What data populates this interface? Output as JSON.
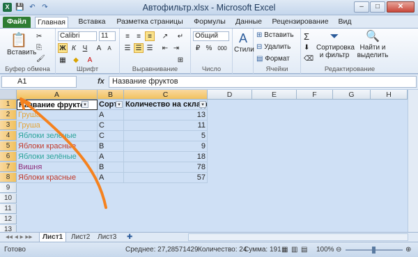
{
  "window": {
    "title": "Автофильтр.xlsx - Microsoft Excel",
    "min": "–",
    "max": "□",
    "close": "✕",
    "logo": "X"
  },
  "quick_access": {
    "save": "💾",
    "undo": "↶",
    "redo": "↷"
  },
  "tabs": [
    {
      "label": "Файл"
    },
    {
      "label": "Главная"
    },
    {
      "label": "Вставка"
    },
    {
      "label": "Разметка страницы"
    },
    {
      "label": "Формулы"
    },
    {
      "label": "Данные"
    },
    {
      "label": "Рецензирование"
    },
    {
      "label": "Вид"
    }
  ],
  "ribbon": {
    "clipboard": {
      "label": "Буфер обмена",
      "paste": "Вставить"
    },
    "font": {
      "label": "Шрифт",
      "name": "Calibri",
      "size": "11",
      "bold": "Ж",
      "italic": "К",
      "underline": "Ч",
      "grow": "A",
      "shrink": "A"
    },
    "alignment": {
      "label": "Выравнивание"
    },
    "number": {
      "label": "Число",
      "format": "Общий",
      "percent": "%",
      "thousands": "000",
      "currency": "₽"
    },
    "styles": {
      "label": "Стили",
      "btn": "Стили"
    },
    "cells": {
      "label": "Ячейки",
      "insert": "Вставить",
      "delete": "Удалить",
      "format": "Формат"
    },
    "editing": {
      "label": "Редактирование",
      "sum": "Σ",
      "sort": "Сортировка\nи фильтр",
      "sort1": "Сортировка",
      "sort2": "и фильтр",
      "find1": "Найти и",
      "find2": "выделить"
    }
  },
  "formula_bar": {
    "name_box": "A1",
    "fx": "fx",
    "value": "Название фруктов"
  },
  "columns": [
    "A",
    "B",
    "C",
    "D",
    "E",
    "F",
    "G",
    "H"
  ],
  "rows": [
    "1",
    "2",
    "3",
    "4",
    "5",
    "6",
    "7",
    "8",
    "9",
    "10",
    "11",
    "12",
    "13"
  ],
  "sheet_header": {
    "a": "Название фрукто",
    "b": "Сорт",
    "c": "Количество на складе (к"
  },
  "table_rows": [
    {
      "name": "Груша",
      "sort": "A",
      "qty": "13",
      "color": "#e3a43a"
    },
    {
      "name": "Груша",
      "sort": "C",
      "qty": "11",
      "color": "#e3a43a"
    },
    {
      "name": "Яблоки зелёные",
      "sort": "C",
      "qty": "5",
      "color": "#2aa39a"
    },
    {
      "name": "Яблоки красные",
      "sort": "B",
      "qty": "9",
      "color": "#c0392b"
    },
    {
      "name": "Яблоки зелёные",
      "sort": "A",
      "qty": "18",
      "color": "#2aa39a"
    },
    {
      "name": "Вишня",
      "sort": "B",
      "qty": "78",
      "color": "#8e2c7a"
    },
    {
      "name": "Яблоки красные",
      "sort": "A",
      "qty": "57",
      "color": "#c0392b"
    }
  ],
  "sheets": [
    {
      "label": "Лист1"
    },
    {
      "label": "Лист2"
    },
    {
      "label": "Лист3"
    }
  ],
  "status": {
    "ready": "Готово",
    "average": "Среднее: 27,28571429",
    "count": "Количество: 24",
    "sum": "Сумма: 191",
    "zoom": "100%"
  },
  "colors": {
    "selection": "#cfe0f5",
    "active_header": "#f1c15f",
    "arrow": "#f5821f",
    "file_tab": "#2e7d32"
  }
}
